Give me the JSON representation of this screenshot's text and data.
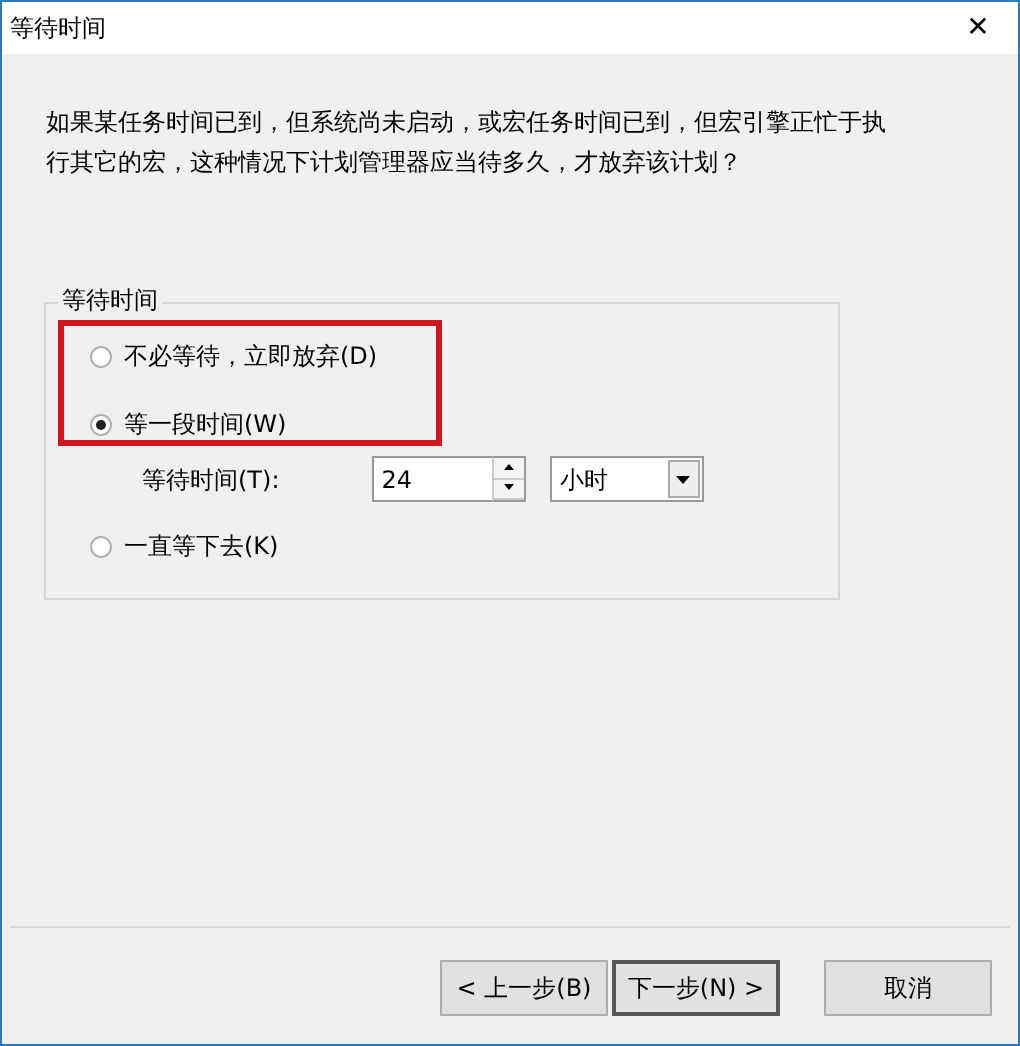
{
  "window": {
    "title": "等待时间",
    "close": "✕"
  },
  "description": "如果某任务时间已到，但系统尚未启动，或宏任务时间已到，但宏引擎正忙于执行其它的宏，这种情况下计划管理器应当待多久，才放弃该计划？",
  "group": {
    "title": "等待时间",
    "options": [
      {
        "label": "不必等待，立即放弃(D)",
        "selected": false
      },
      {
        "label": "等一段时间(W)",
        "selected": true
      },
      {
        "label": "一直等下去(K)",
        "selected": false
      }
    ],
    "highlight_frame": true,
    "wait_time": {
      "label": "等待时间(T):",
      "value": "24",
      "unit": "小时"
    }
  },
  "buttons": [
    {
      "label": "< 上一步(B)",
      "default": false
    },
    {
      "label": "下一步(N) >",
      "default": true
    },
    {
      "label": "取消",
      "default": false
    }
  ]
}
